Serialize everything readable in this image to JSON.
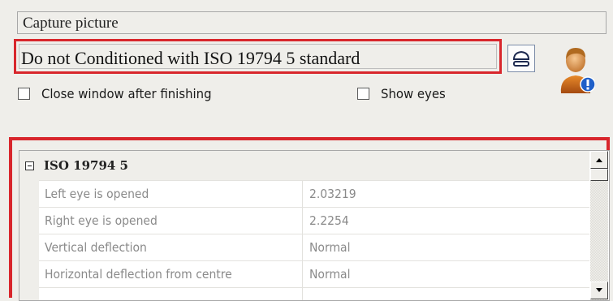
{
  "window": {
    "title": "Capture picture"
  },
  "status": {
    "message": "Do not Conditioned with ISO 19794 5  standard"
  },
  "options": {
    "close_after": {
      "label": "Close window after finishing",
      "checked": false
    },
    "show_eyes": {
      "label": "Show eyes",
      "checked": false
    }
  },
  "property_grid": {
    "category": "ISO 19794 5",
    "rows": [
      {
        "name": "Left eye is opened",
        "value": "2.03219"
      },
      {
        "name": "Right eye is opened",
        "value": "2.2254"
      },
      {
        "name": "Vertical deflection",
        "value": "Normal"
      },
      {
        "name": "Horizontal deflection from centre",
        "value": "Normal"
      }
    ]
  },
  "colors": {
    "highlight": "#d8262c",
    "panel": "#efeeea"
  },
  "icons": {
    "eject": "eject-icon",
    "user_alert": "user-alert-icon"
  }
}
